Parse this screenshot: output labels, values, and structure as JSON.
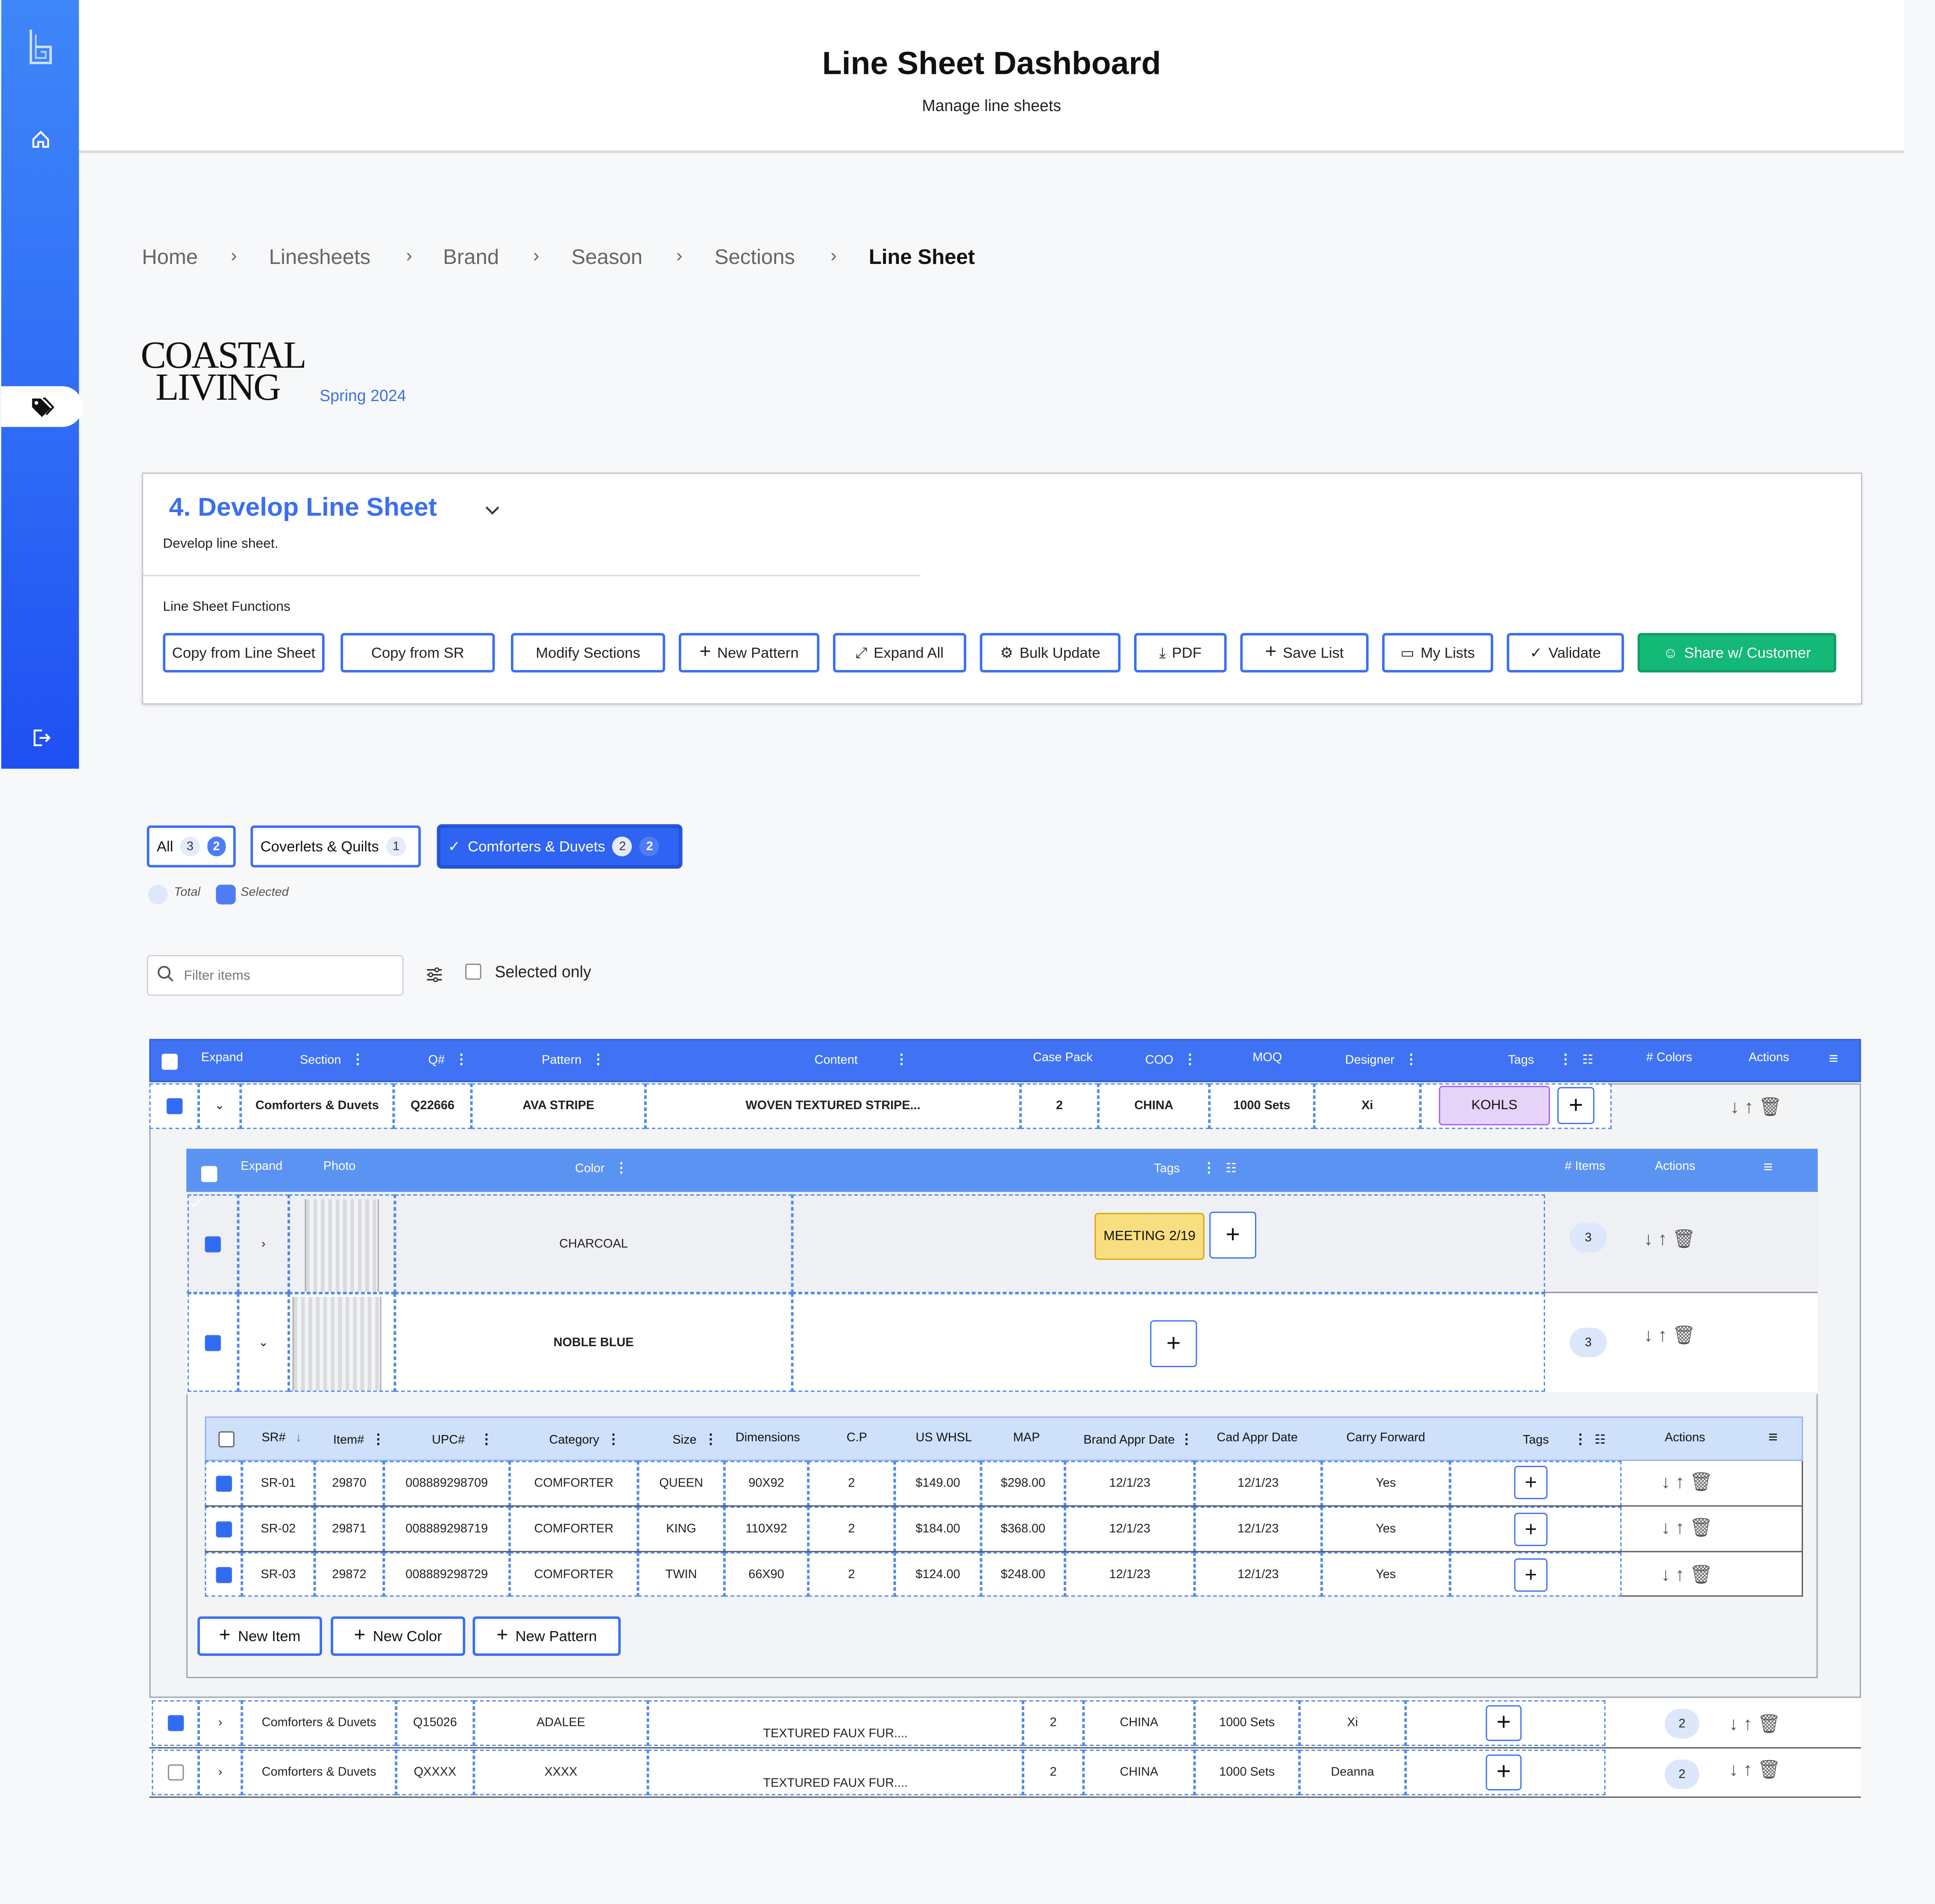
{
  "header": {
    "title": "Line Sheet Dashboard",
    "subtitle": "Manage line sheets"
  },
  "breadcrumb": [
    "Home",
    "Linesheets",
    "Brand",
    "Season",
    "Sections",
    "Line Sheet"
  ],
  "brand": {
    "logo_line1": "COASTAL",
    "logo_line2": "LIVING",
    "season": "Spring 2024"
  },
  "step": {
    "title": "4. Develop Line Sheet",
    "description": "Develop line sheet.",
    "functions_label": "Line Sheet Functions"
  },
  "functions": [
    "Copy from Line Sheet",
    "Copy from SR",
    "Modify Sections",
    "New Pattern",
    "Expand All",
    "Bulk Update",
    "PDF",
    "Save List",
    "My Lists",
    "Validate",
    "Share w/ Customer"
  ],
  "section_chips": [
    {
      "label": "All",
      "total": "3",
      "selected": "2"
    },
    {
      "label": "Coverlets & Quilts",
      "total": "1"
    },
    {
      "label": "Comforters & Duvets",
      "total": "2",
      "selected": "2"
    }
  ],
  "legend": {
    "total": "Total",
    "selected": "Selected"
  },
  "filter": {
    "placeholder": "Filter items",
    "selected_only": "Selected only"
  },
  "main_table": {
    "headers": [
      "Expand",
      "Section",
      "Q#",
      "Pattern",
      "Content",
      "Case Pack",
      "COO",
      "MOQ",
      "Designer",
      "Tags",
      "# Colors",
      "Actions"
    ],
    "rows": [
      {
        "section": "Comforters & Duvets",
        "q": "Q22666",
        "pattern": "AVA STRIPE",
        "content": "WOVEN TEXTURED STRIPE...",
        "case_pack": "2",
        "coo": "CHINA",
        "moq": "1000 Sets",
        "designer": "Xi",
        "tag": "KOHLS"
      },
      {
        "section": "Comforters & Duvets",
        "q": "Q15026",
        "pattern": "ADALEE",
        "content": "TEXTURED FAUX FUR....",
        "case_pack": "2",
        "coo": "CHINA",
        "moq": "1000 Sets",
        "designer": "Xi",
        "colors": "2"
      },
      {
        "section": "Comforters & Duvets",
        "q": "QXXXX",
        "pattern": "XXXX",
        "content": "TEXTURED FAUX FUR....",
        "case_pack": "2",
        "coo": "CHINA",
        "moq": "1000 Sets",
        "designer": "Deanna",
        "colors": "2"
      }
    ]
  },
  "color_table": {
    "headers": [
      "Expand",
      "Photo",
      "Color",
      "Tags",
      "# Items",
      "Actions"
    ],
    "rows": [
      {
        "color": "CHARCOAL",
        "tag": "MEETING 2/19",
        "items": "3"
      },
      {
        "color": "NOBLE BLUE",
        "items": "3"
      }
    ]
  },
  "item_table": {
    "headers": [
      "SR#",
      "Item#",
      "UPC#",
      "Category",
      "Size",
      "Dimensions",
      "C.P",
      "US WHSL",
      "MAP",
      "Brand Appr Date",
      "Cad Appr Date",
      "Carry Forward",
      "Tags",
      "Actions"
    ],
    "rows": [
      [
        "SR-01",
        "29870",
        "008889298709",
        "COMFORTER",
        "QUEEN",
        "90X92",
        "2",
        "$149.00",
        "$298.00",
        "12/1/23",
        "12/1/23",
        "Yes"
      ],
      [
        "SR-02",
        "29871",
        "008889298719",
        "COMFORTER",
        "KING",
        "110X92",
        "2",
        "$184.00",
        "$368.00",
        "12/1/23",
        "12/1/23",
        "Yes"
      ],
      [
        "SR-03",
        "29872",
        "008889298729",
        "COMFORTER",
        "TWIN",
        "66X90",
        "2",
        "$124.00",
        "$248.00",
        "12/1/23",
        "12/1/23",
        "Yes"
      ]
    ]
  },
  "sub_buttons": [
    "New Item",
    "New Color",
    "New Pattern"
  ],
  "colors": {
    "primary": "#2f63f1",
    "header_blue": "#3f73f3",
    "light_header": "#5b93f2",
    "success": "#14b877",
    "kohls_tag": "#e5d4f7",
    "meeting_tag": "#f8de7e"
  }
}
